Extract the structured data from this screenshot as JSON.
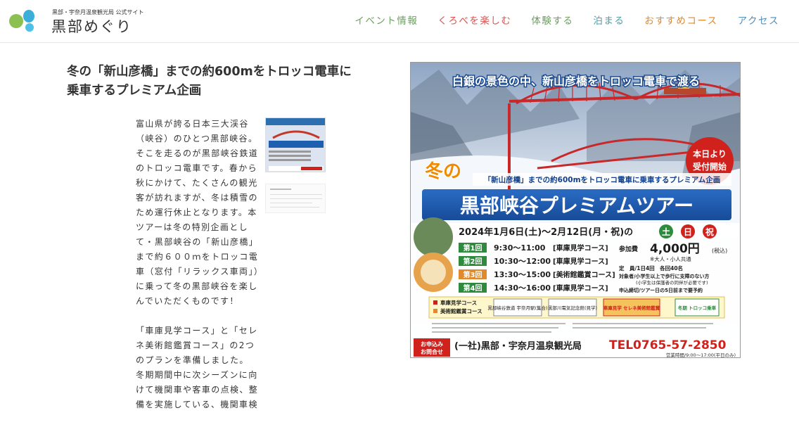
{
  "header": {
    "logo_sub": "黒部・宇奈月温泉観光局 公式サイト",
    "logo_title": "黒部めぐり",
    "nav": [
      {
        "label": "イベント情報",
        "color": "#6a9f5e"
      },
      {
        "label": "くろべを楽しむ",
        "color": "#d9534f"
      },
      {
        "label": "体験する",
        "color": "#6a9f5e"
      },
      {
        "label": "泊まる",
        "color": "#4f9fa8"
      },
      {
        "label": "おすすめコース",
        "color": "#e08a2b"
      },
      {
        "label": "アクセス",
        "color": "#4a8fc2"
      }
    ]
  },
  "article": {
    "heading": "冬の「新山彦橋」までの約600mをトロッコ電車に乗車するプレミアム企画",
    "paragraph1": "富山県が誇る日本三大渓谷（峡谷）のひとつ黒部峡谷。そこを走るのが黒部峡谷鉄道のトロッコ電車です。春から秋にかけて、たくさんの観光客が訪れますが、冬は積雪のため運行休止となります。本ツアーは冬の特別企画として・黒部峡谷の「新山彦橋」まで約６００ｍをトロッコ電車（窓付「リラックス車両」）に乗って冬の黒部峡谷を楽しんでいただくものです！",
    "paragraph2": "「車庫見学コース」と「セレネ美術館鑑賞コース」の2つのプランを準備しました。",
    "paragraph3": "冬期期間中に次シーズンに向けて機関車や客車の点検、整備を実施している、機関車検"
  },
  "poster": {
    "top_banner": "白銀の景色の中、新山彦橋をトロッコ電車で渡る",
    "badge": "本日より受付開始",
    "winter": "冬の",
    "subtitle": "「新山彦橋」までの約600mをトロッコ電車に乗車するプレミアム企画",
    "main_title": "黒部峡谷プレミアムツアー",
    "dates": "2024年1月6日(土)〜2月12日(月・祝)の",
    "days": [
      "土",
      "日",
      "祝"
    ],
    "sessions": [
      {
        "no": "第1回",
        "time": "9:30〜11:00",
        "course": "[車庫見学コース]"
      },
      {
        "no": "第2回",
        "time": "10:30〜12:00",
        "course": "[車庫見学コース]"
      },
      {
        "no": "第3回",
        "time": "13:30〜15:00",
        "course": "[美術館鑑賞コース]"
      },
      {
        "no": "第4回",
        "time": "14:30〜16:00",
        "course": "[車庫見学コース]"
      }
    ],
    "fee_label": "参加費",
    "fee": "4,000円",
    "fee_tax": "(税込)",
    "fee_note": "※大人・小人共通",
    "capacity": "定　員/1日4回　各回40名",
    "target": "対象者/小学生以上で歩行に支障のない方",
    "target_note": "(小学生は保護者の同伴が必要です)",
    "deadline": "申込締切/ツアー日の5日前まで要予約",
    "legend1": "車庫見学コース",
    "legend2": "美術館鑑賞コース",
    "route": [
      "黒部峡谷鉄道 宇奈月駅(集合)",
      "黒部川電気記念館(見学)",
      "車庫見学 セレネ美術館鑑賞",
      "冬期 トロッコ乗車"
    ],
    "contact_label": "お申込み お問合せ",
    "org": "(一社)黒部・宇奈月温泉観光局",
    "tel": "TEL0765-57-2850",
    "hours": "営業時間/9:00〜17:00(平日のみ)"
  }
}
